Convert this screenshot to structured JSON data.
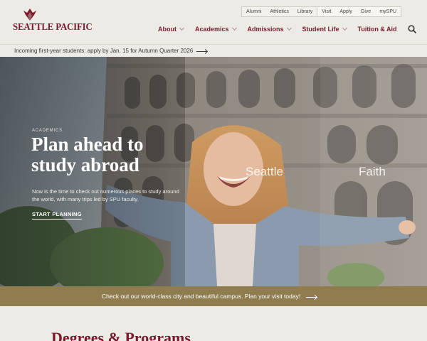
{
  "brand": {
    "name": "SEATTLE PACIFIC",
    "color": "#7a1a2c"
  },
  "utility_nav": {
    "left": [
      "Alumni",
      "Athletics",
      "Library"
    ],
    "right": [
      "Visit",
      "Apply",
      "Give",
      "mySPU"
    ]
  },
  "main_nav": {
    "items": [
      {
        "label": "About",
        "has_menu": true
      },
      {
        "label": "Academics",
        "has_menu": true
      },
      {
        "label": "Admissions",
        "has_menu": true
      },
      {
        "label": "Student Life",
        "has_menu": true
      },
      {
        "label": "Tuition & Aid",
        "has_menu": false
      }
    ],
    "search_icon": "search-icon"
  },
  "announcement": {
    "text": "Incoming first-year students: apply by Jan. 15 for Autumn Quarter 2026"
  },
  "hero": {
    "eyebrow": "ACADEMICS",
    "title": "Plan ahead to study abroad",
    "body": "Now is the time to check out numerous places to study around the world, with many trips led by SPU faculty.",
    "cta": "START PLANNING",
    "panels": [
      "Seattle",
      "Faith"
    ]
  },
  "visit_banner": {
    "text": "Check out our world-class city and beautiful campus. Plan your visit today!",
    "color": "#8f7d4f"
  },
  "degrees": {
    "title": "Degrees & Programs"
  }
}
